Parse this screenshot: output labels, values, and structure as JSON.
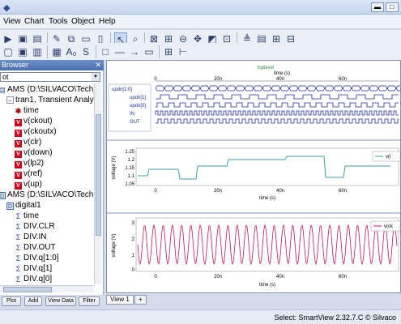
{
  "menu": {
    "items": [
      "View",
      "Chart",
      "Tools",
      "Object",
      "Help"
    ]
  },
  "left_panel": {
    "title": "Browser",
    "combo_value": "ot",
    "tree": [
      {
        "label": "AMS (D:\\SILVACO\\Tech_N",
        "icon": "folder-icon",
        "depth": 0
      },
      {
        "label": "tran1, Transient Analysis",
        "icon": "collapse-icon",
        "depth": 1
      },
      {
        "label": "time",
        "icon": "time-icon",
        "depth": 2
      },
      {
        "label": "v(ckout)",
        "icon": "voltage-icon",
        "depth": 2
      },
      {
        "label": "v(ckoutx)",
        "icon": "voltage-icon",
        "depth": 2
      },
      {
        "label": "v(clr)",
        "icon": "voltage-icon",
        "depth": 2
      },
      {
        "label": "v(down)",
        "icon": "voltage-icon",
        "depth": 2
      },
      {
        "label": "v(lp2)",
        "icon": "voltage-icon",
        "depth": 2
      },
      {
        "label": "v(ref)",
        "icon": "voltage-icon",
        "depth": 2
      },
      {
        "label": "v(up)",
        "icon": "voltage-icon",
        "depth": 2
      },
      {
        "label": "AMS (D:\\SILVACO\\Tech",
        "icon": "dataset-icon",
        "depth": 0
      },
      {
        "label": "digital1",
        "icon": "dataset-icon",
        "depth": 1
      },
      {
        "label": "time",
        "icon": "signal-icon",
        "depth": 2
      },
      {
        "label": "DIV.CLR",
        "icon": "signal-icon",
        "depth": 2
      },
      {
        "label": "DIV.IN",
        "icon": "signal-icon",
        "depth": 2
      },
      {
        "label": "DIV.OUT",
        "icon": "signal-icon",
        "depth": 2
      },
      {
        "label": "DIV.q[1:0]",
        "icon": "signal-icon",
        "depth": 2
      },
      {
        "label": "DIV.q[1]",
        "icon": "signal-icon",
        "depth": 2
      },
      {
        "label": "DIV.q[0]",
        "icon": "signal-icon",
        "depth": 2
      }
    ],
    "buttons": [
      "Plot",
      "Add",
      "View Data",
      "Filter"
    ]
  },
  "plots": {
    "digital": {
      "title": "toplevel",
      "xlabel": "time (s)",
      "signals": [
        "updn[1:0]",
        "updn[1]",
        "updn[0]",
        "IN",
        "OUT"
      ],
      "ticks": [
        "0",
        "20n",
        "40n",
        "60n"
      ]
    },
    "analog1": {
      "ylabel": "voltage (V)",
      "xlabel": "time (s)",
      "yticks": [
        "1.25",
        "1.2",
        "1.15",
        "1.1",
        "1.05"
      ],
      "xticks": [
        "0",
        "20n",
        "40n",
        "60n"
      ],
      "legend": "v(l"
    },
    "analog2": {
      "ylabel": "voltage (V)",
      "xlabel": "time (s)",
      "yticks": [
        "3",
        "2",
        "1",
        "0"
      ],
      "xticks": [
        "0",
        "20n",
        "40n",
        "60n"
      ],
      "legend": "v(ck"
    }
  },
  "tabs": [
    "View 1",
    "+"
  ],
  "status": "Select: SmartView 2.32.7.C © Silvaco"
}
